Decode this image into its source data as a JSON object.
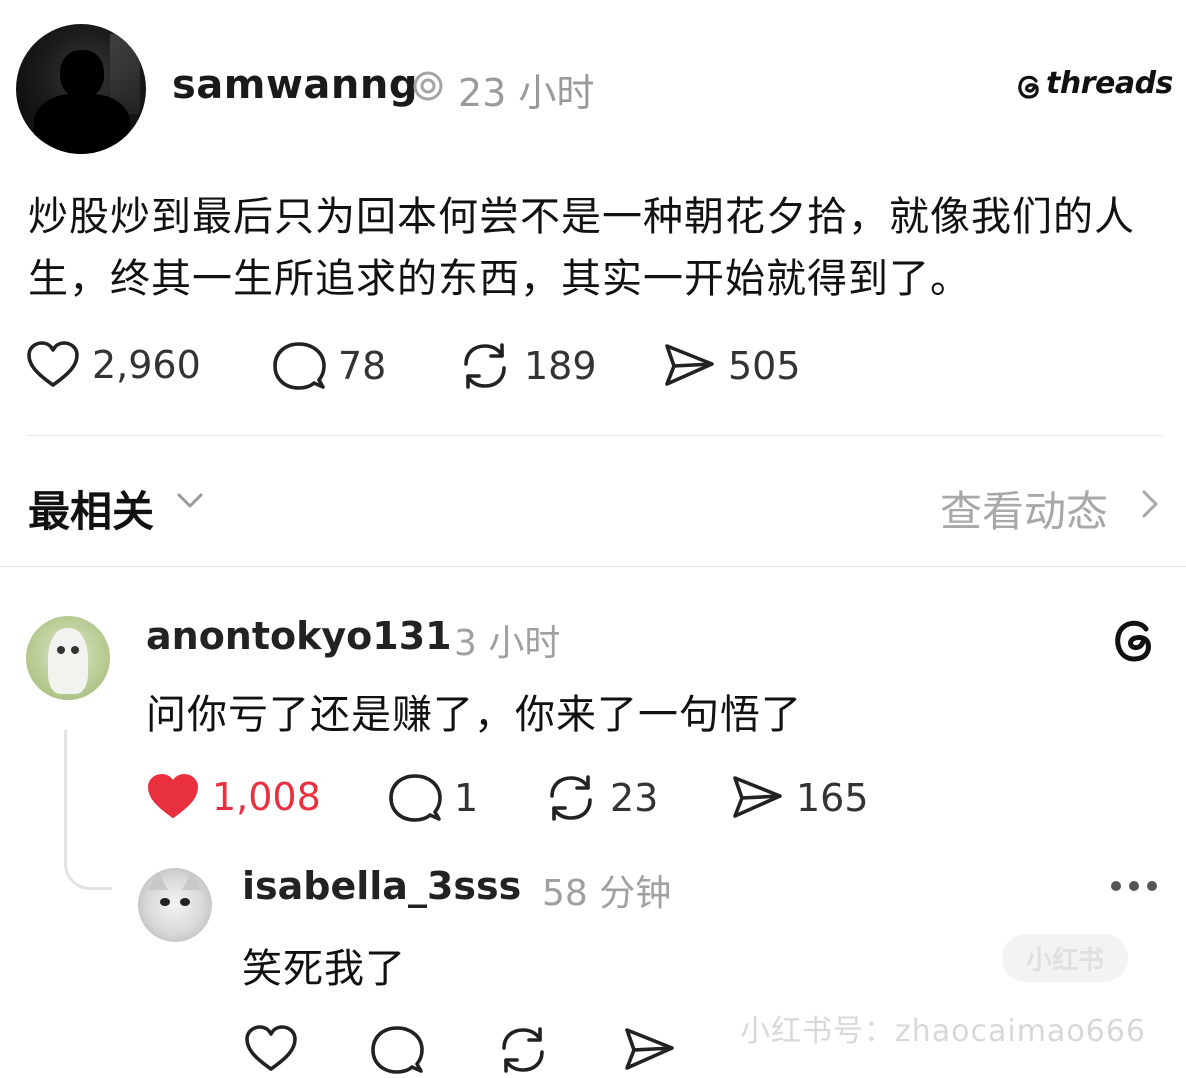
{
  "post": {
    "username": "samwanng",
    "time": "23 小时",
    "brand": "threads",
    "text": "炒股炒到最后只为回本何尝不是一种朝花夕拾，就像我们的人生，终其一生所追求的东西，其实一开始就得到了。",
    "likes": "2,960",
    "comments": "78",
    "reposts": "189",
    "shares": "505"
  },
  "sort": {
    "label": "最相关",
    "activity": "查看动态"
  },
  "comments": [
    {
      "username": "anontokyo131",
      "time": "3 小时",
      "text": "问你亏了还是赚了，你来了一句悟了",
      "likes": "1,008",
      "liked": true,
      "comments": "1",
      "reposts": "23",
      "shares": "165"
    },
    {
      "username": "isabella_3sss",
      "time": "58 分钟",
      "text": "笑死我了"
    }
  ],
  "watermark": {
    "badge": "小红书",
    "text": "小红书号：zhaocaimao666"
  },
  "colors": {
    "like_active": "#e8303f",
    "muted": "#a0a0a0",
    "text": "#111111"
  }
}
